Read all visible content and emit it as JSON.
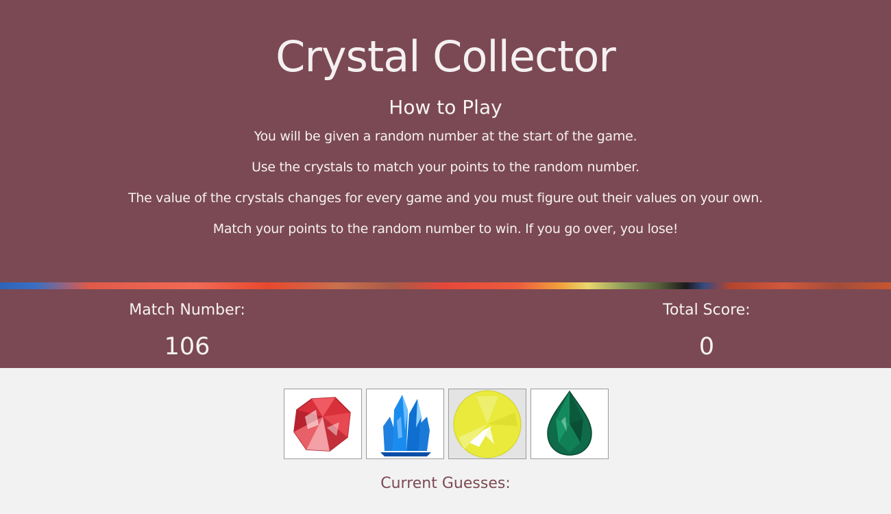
{
  "header": {
    "title": "Crystal Collector",
    "how_to_heading": "How to Play",
    "rules": [
      "You will be given a random number at the start of the game.",
      "Use the crystals to match your points to the random number.",
      "The value of the crystals changes for every game and you must figure out their values on your own.",
      "Match your points to the random number to win. If you go over, you lose!"
    ]
  },
  "scoreboard": {
    "match_label": "Match Number:",
    "match_value": "106",
    "score_label": "Total Score:",
    "score_value": "0"
  },
  "crystals": [
    {
      "icon": "red-crystal-icon",
      "color": "#d8313c"
    },
    {
      "icon": "blue-crystal-icon",
      "color": "#1c7fe0"
    },
    {
      "icon": "yellow-crystal-icon",
      "color": "#e9ea3c"
    },
    {
      "icon": "green-crystal-icon",
      "color": "#0f6b4a"
    }
  ],
  "guesses": {
    "label": "Current Guesses:"
  },
  "colors": {
    "accent": "#7b4953",
    "background": "#f2f2f2"
  }
}
